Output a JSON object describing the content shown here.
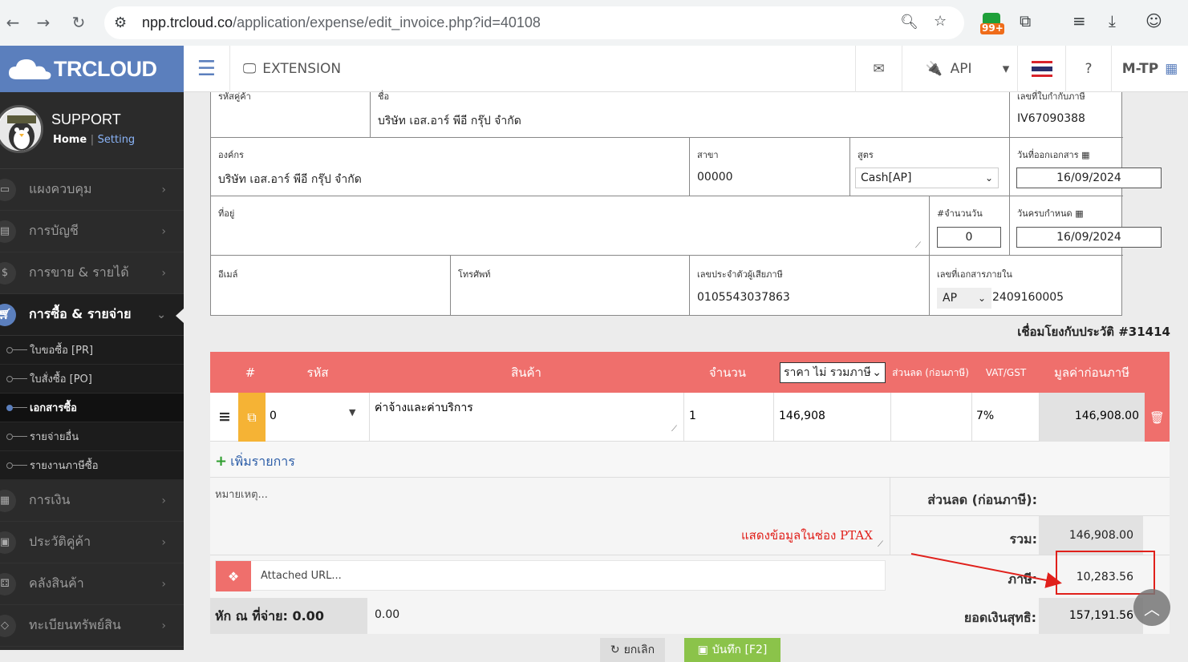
{
  "browser": {
    "url_host": "npp.trcloud.co",
    "url_path": "/application/expense/edit_invoice.php?id=40108",
    "badge": "99+"
  },
  "app": {
    "logo": "TRCLOUD",
    "extension_label": "EXTENSION",
    "api_label": "API",
    "user_code": "M-TP"
  },
  "profile": {
    "name": "SUPPORT",
    "home": "Home",
    "separator": "|",
    "setting": "Setting"
  },
  "sidebar": {
    "items_top": [
      {
        "label": "แผงควบคุม",
        "icon": "monitor-icon"
      },
      {
        "label": "การบัญชี",
        "icon": "book-icon"
      },
      {
        "label": "การขาย & รายได้",
        "icon": "dollar-icon"
      }
    ],
    "active": {
      "label": "การซื้อ & รายจ่าย",
      "icon": "cart-icon"
    },
    "sub_items": [
      {
        "label": "ใบขอซื้อ [PR]"
      },
      {
        "label": "ใบสั่งซื้อ [PO]"
      },
      {
        "label": "เอกสารซื้อ"
      },
      {
        "label": "รายจ่ายอื่น"
      },
      {
        "label": "รายงานภาษีซื้อ"
      }
    ],
    "items_bottom": [
      {
        "label": "การเงิน",
        "icon": "calendar-icon"
      },
      {
        "label": "ประวัติคู่ค้า",
        "icon": "contact-icon"
      },
      {
        "label": "คลังสินค้า",
        "icon": "boxes-icon"
      },
      {
        "label": "ทะเบียนทรัพย์สิน",
        "icon": "diamond-icon"
      }
    ]
  },
  "form": {
    "supplier_code_label": "รหัสคู่ค้า",
    "name_label": "ชื่อ",
    "name_value": "บริษัท เอส.อาร์ พีอี กรุ๊ป จำกัด",
    "tax_invoice_label": "เลขที่ใบกำกับภาษี",
    "tax_invoice_value": "IV67090388",
    "org_label": "องค์กร",
    "org_value": "บริษัท เอส.อาร์ พีอี กรุ๊ป จำกัด",
    "branch_label": "สาขา",
    "branch_value": "00000",
    "formula_label": "สูตร",
    "formula_value": "Cash[AP]",
    "doc_date_label": "วันที่ออกเอกสาร",
    "doc_date_value": "16/09/2024",
    "address_label": "ที่อยู่",
    "days_label": "#จำนวนวัน",
    "days_value": "0",
    "due_label": "วันครบกำหนด",
    "due_value": "16/09/2024",
    "email_label": "อีเมล์",
    "phone_label": "โทรศัพท์",
    "taxid_label": "เลขประจำตัวผู้เสียภาษี",
    "taxid_value": "0105543037863",
    "internal_label": "เลขที่เอกสารภายใน",
    "internal_prefix": "AP",
    "internal_value": "2409160005"
  },
  "history_link": "เชื่อมโยงกับประวัติ #31414",
  "table": {
    "headers": {
      "num": "#",
      "code": "รหัส",
      "product": "สินค้า",
      "qty": "จำนวน",
      "price_select": "ราคา ไม่ รวมภาษี",
      "discount": "ส่วนลด (ก่อนภาษี)",
      "vat": "VAT/GST",
      "amount": "มูลค่าก่อนภาษี"
    },
    "row": {
      "code": "0",
      "product": "ค่าจ้างและค่าบริการ",
      "qty": "1",
      "price": "146,908",
      "discount": "",
      "vat": "7%",
      "amount": "146,908.00"
    },
    "add_label": "เพิ่มรายการ"
  },
  "notes": {
    "placeholder": "หมายเหตุ...",
    "annotation": "แสดงข้อมูลในช่อง PTAX",
    "url_placeholder": "Attached URL..."
  },
  "summary": {
    "discount_label": "ส่วนลด (ก่อนภาษี):",
    "discount_value": "",
    "total_label": "รวม:",
    "total_value": "146,908.00",
    "tax_label": "ภาษี:",
    "tax_value": "10,283.56",
    "net_label": "ยอดเงินสุทธิ:",
    "net_value": "157,191.56"
  },
  "withholding": {
    "label": "หัก ณ ที่จ่าย: 0.00",
    "value": "0.00"
  },
  "buttons": {
    "cancel": "ยกเลิก",
    "save": "บันทึก [F2]"
  },
  "colors": {
    "brand": "#5b7fbd",
    "header_red": "#ef6f6c",
    "annotation_red": "#e0201b",
    "copy_yellow": "#f5b335"
  }
}
